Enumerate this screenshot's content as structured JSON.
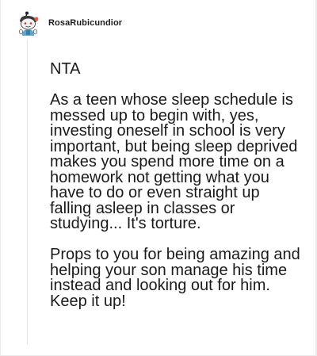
{
  "comment": {
    "username": "RosaRubicundior",
    "avatar_icon": "snoo-avatar-icon",
    "paragraphs": [
      "NTA",
      "As a teen whose sleep schedule is messed up to begin with, yes, investing oneself in school is very important, but being sleep deprived makes you spend more time on a homework not getting what you have to do or even straight up falling asleep in classes or studying... It's torture.",
      "Props to you for being amazing and helping your son manage his time instead and looking out for him. Keep it up!"
    ]
  },
  "colors": {
    "page_background": "#ebebeb",
    "card_background": "#ffffff",
    "text": "#1a1a1b",
    "thread_line": "#e4e4e4"
  }
}
